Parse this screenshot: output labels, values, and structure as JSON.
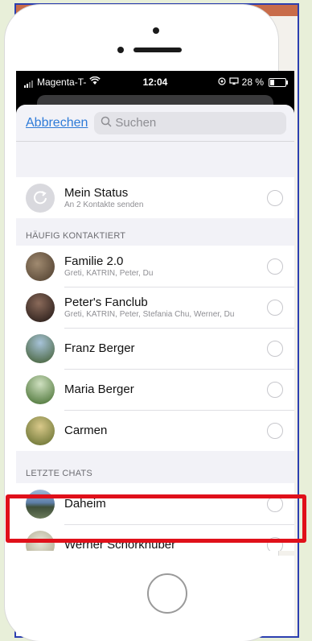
{
  "status_bar": {
    "carrier": "Magenta-T-",
    "time": "12:04",
    "battery": "28 %",
    "battery_level": 0.28
  },
  "search": {
    "cancel_label": "Abbrechen",
    "placeholder": "Suchen"
  },
  "my_status": {
    "title": "Mein Status",
    "subtitle": "An 2 Kontakte senden"
  },
  "frequent": {
    "header": "HÄUFIG KONTAKTIERT",
    "items": [
      {
        "title": "Familie 2.0",
        "subtitle": "Greti, KATRIN, Peter, Du",
        "color": "#6b5a4a"
      },
      {
        "title": "Peter's Fanclub",
        "subtitle": "Greti, KATRIN, Peter, Stefania Chu, Werner, Du",
        "color": "#3b2a25"
      },
      {
        "title": "Franz Berger",
        "subtitle": "",
        "color": "#4d6b3a"
      },
      {
        "title": "Maria Berger",
        "subtitle": "",
        "color": "#5f7d3e"
      },
      {
        "title": "Carmen",
        "subtitle": "",
        "color": "#8a7a3a"
      }
    ]
  },
  "recent": {
    "header": "LETZTE CHATS",
    "items": [
      {
        "title": "Daheim",
        "subtitle": "",
        "color": "#4a6e9c"
      },
      {
        "title": "Werner Schörkhuber",
        "subtitle": "",
        "color": "#b9b49a"
      }
    ]
  },
  "colors": {
    "accent": "#2e7bd8",
    "highlight": "#e0101a"
  }
}
